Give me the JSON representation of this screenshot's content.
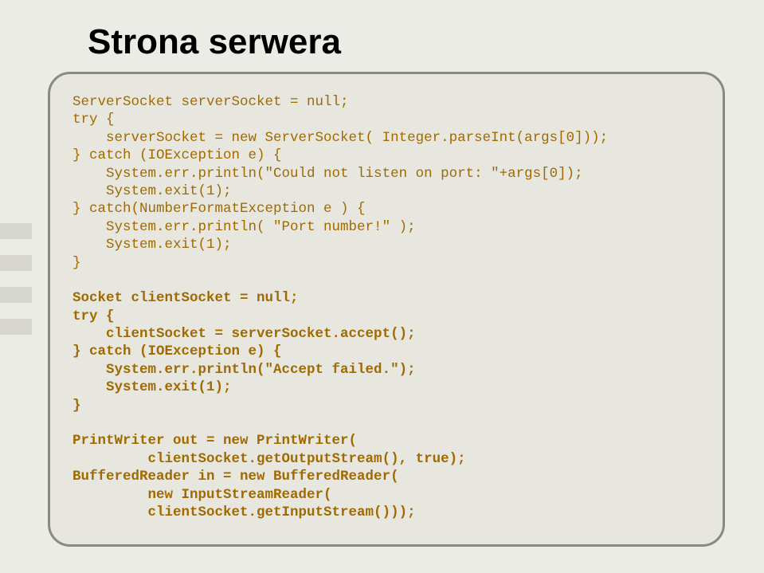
{
  "title": "Strona serwera",
  "code": {
    "l01": "ServerSocket serverSocket = null;",
    "l02": "try {",
    "l03": "    serverSocket = new ServerSocket( Integer.parseInt(args[0]));",
    "l04": "} catch (IOException e) {",
    "l05": "    System.err.println(\"Could not listen on port: \"+args[0]);",
    "l06": "    System.exit(1);",
    "l07": "} catch(NumberFormatException e ) {",
    "l08": "    System.err.println( \"Port number!\" );",
    "l09": "    System.exit(1);",
    "l10": "}",
    "l11": "",
    "l12": "Socket clientSocket = null;",
    "l13": "try {",
    "l14": "    clientSocket = serverSocket.accept();",
    "l15": "} catch (IOException e) {",
    "l16": "    System.err.println(\"Accept failed.\");",
    "l17": "    System.exit(1);",
    "l18": "}",
    "l19": "",
    "l20": "PrintWriter out = new PrintWriter(",
    "l21": "         clientSocket.getOutputStream(), true);",
    "l22": "BufferedReader in = new BufferedReader(",
    "l23": "         new InputStreamReader(",
    "l24": "         clientSocket.getInputStream()));"
  }
}
